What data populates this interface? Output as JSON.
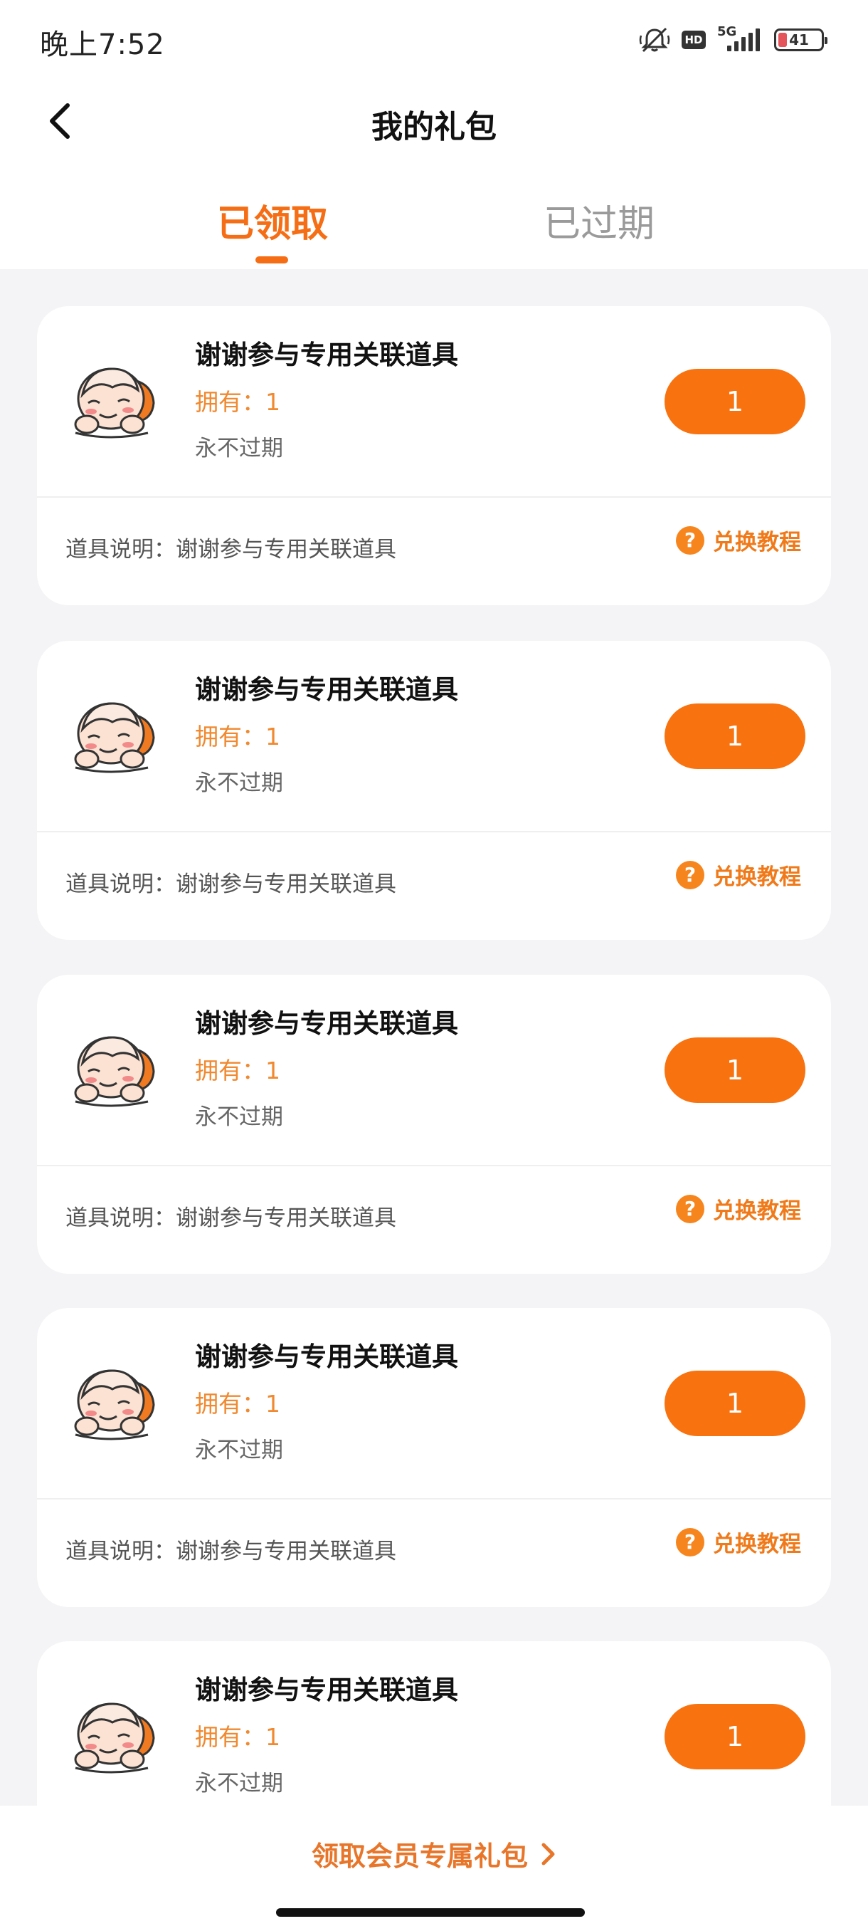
{
  "status_bar": {
    "time": "晚上7:52",
    "hd": "HD",
    "network": "5G",
    "battery": "41"
  },
  "header": {
    "title": "我的礼包"
  },
  "tabs": [
    {
      "label": "已领取",
      "active": true
    },
    {
      "label": "已过期",
      "active": false
    }
  ],
  "cards": [
    {
      "name": "谢谢参与专用关联道具",
      "owned": "拥有：1",
      "expire": "永不过期",
      "count": "1",
      "desc": "道具说明：谢谢参与专用关联道具",
      "tutorial": "兑换教程"
    },
    {
      "name": "谢谢参与专用关联道具",
      "owned": "拥有：1",
      "expire": "永不过期",
      "count": "1",
      "desc": "道具说明：谢谢参与专用关联道具",
      "tutorial": "兑换教程"
    },
    {
      "name": "谢谢参与专用关联道具",
      "owned": "拥有：1",
      "expire": "永不过期",
      "count": "1",
      "desc": "道具说明：谢谢参与专用关联道具",
      "tutorial": "兑换教程"
    },
    {
      "name": "谢谢参与专用关联道具",
      "owned": "拥有：1",
      "expire": "永不过期",
      "count": "1",
      "desc": "道具说明：谢谢参与专用关联道具",
      "tutorial": "兑换教程"
    },
    {
      "name": "谢谢参与专用关联道具",
      "owned": "拥有：1",
      "expire": "永不过期",
      "count": "1",
      "desc": "",
      "tutorial": ""
    }
  ],
  "bottom": {
    "member_link": "领取会员专属礼包"
  },
  "colors": {
    "accent": "#f56e15",
    "button": "#f8720f",
    "owned_text": "#f0892f"
  },
  "icons": {
    "back": "chevron-left-icon",
    "help": "question-circle-icon",
    "more": "chevron-right-icon",
    "mute": "bell-muted-icon",
    "signal": "signal-bars-icon",
    "battery": "battery-icon"
  }
}
